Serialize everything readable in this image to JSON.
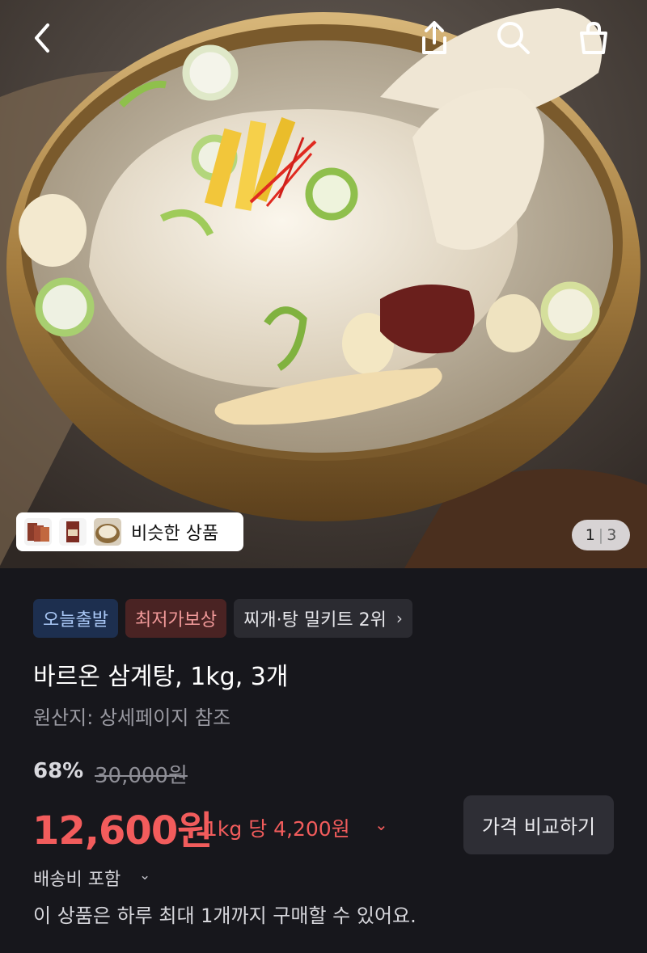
{
  "header": {
    "back_icon": "chevron-left-icon",
    "share_icon": "share-icon",
    "search_icon": "search-icon",
    "cart_icon": "shopping-bag-icon"
  },
  "gallery": {
    "similar_label": "비슷한 상품",
    "page_current": "1",
    "page_separator": "|",
    "page_total": "3"
  },
  "badges": {
    "today_shipping": "오늘출발",
    "lowest_price": "최저가보상",
    "ranking": "찌개·탕 밀키트 2위"
  },
  "product": {
    "title": "바르온 삼계탕, 1kg, 3개",
    "origin": "원산지: 상세페이지 참조"
  },
  "pricing": {
    "discount": "68%",
    "original_price": "30,000원",
    "sale_price": "12,600원",
    "unit_price": "1kg 당 4,200원",
    "compare_button": "가격 비교하기"
  },
  "shipping": {
    "label": "배송비 포함",
    "purchase_limit": "이 상품은 하루 최대 1개까지 구매할 수 있어요."
  },
  "colors": {
    "background": "#17171c",
    "price_red": "#f25c5c",
    "badge_blue_bg": "#1d2f4f",
    "badge_red_bg": "#4a2323"
  }
}
